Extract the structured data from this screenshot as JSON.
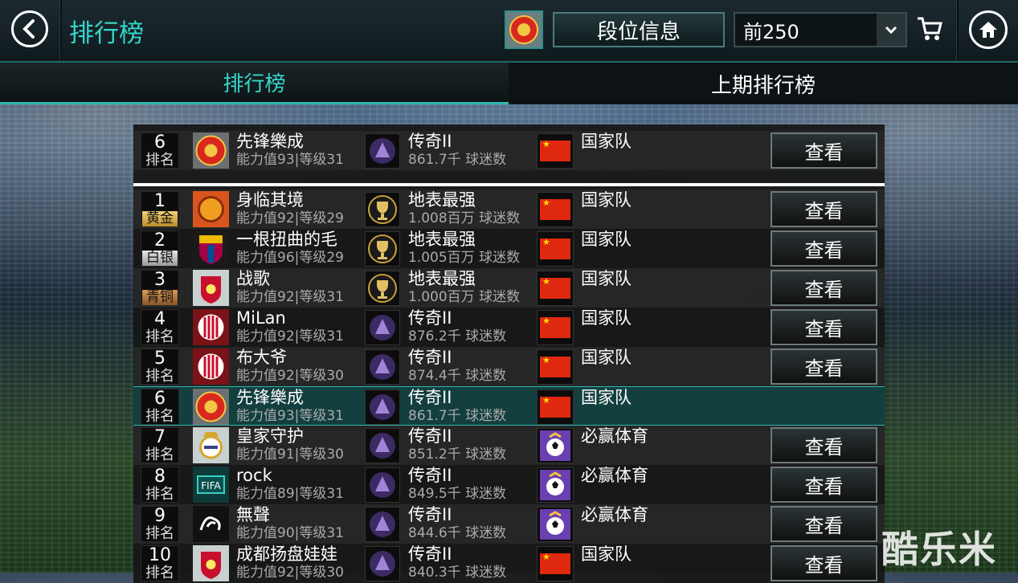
{
  "header": {
    "title": "排行榜",
    "rank_info_label": "段位信息",
    "range_value": "前250"
  },
  "tabs": [
    {
      "label": "排行榜",
      "active": true
    },
    {
      "label": "上期排行榜",
      "active": false
    }
  ],
  "my_row": {
    "rank": "6",
    "rank_label": "排名",
    "name": "先锋樂成",
    "stats": "能力值93|等级31",
    "division": "传奇II",
    "fans": "861.7千 球迷数",
    "team": "国家队",
    "view": "查看"
  },
  "rows": [
    {
      "rank": "1",
      "rank_label": "黄金",
      "tier": "gold",
      "club": "dragon",
      "name": "身临其境",
      "stats": "能力值92|等级29",
      "division": "地表最强",
      "div_icon": "trophy",
      "fans": "1.008百万 球迷数",
      "nation": "cn",
      "team": "国家队",
      "view": "查看"
    },
    {
      "rank": "2",
      "rank_label": "白银",
      "tier": "plat",
      "club": "barca",
      "name": "一根扭曲的毛",
      "stats": "能力值96|等级29",
      "division": "地表最强",
      "div_icon": "trophy",
      "fans": "1.005百万 球迷数",
      "nation": "cn",
      "team": "国家队",
      "view": "查看"
    },
    {
      "rank": "3",
      "rank_label": "青铜",
      "tier": "bronze",
      "club": "liverpool",
      "name": "战歌",
      "stats": "能力值92|等级31",
      "division": "地表最强",
      "div_icon": "trophy",
      "fans": "1.000百万 球迷数",
      "nation": "cn",
      "team": "国家队",
      "view": "查看"
    },
    {
      "rank": "4",
      "rank_label": "排名",
      "tier": "",
      "club": "milan",
      "name": "MiLan",
      "stats": "能力值92|等级31",
      "division": "传奇II",
      "div_icon": "legend",
      "fans": "876.2千 球迷数",
      "nation": "cn",
      "team": "国家队",
      "view": "查看"
    },
    {
      "rank": "5",
      "rank_label": "排名",
      "tier": "",
      "club": "milan",
      "name": "布大爷",
      "stats": "能力值92|等级30",
      "division": "传奇II",
      "div_icon": "legend",
      "fans": "874.4千 球迷数",
      "nation": "cn",
      "team": "国家队",
      "view": "查看"
    },
    {
      "rank": "6",
      "rank_label": "排名",
      "tier": "",
      "club": "manutd",
      "name": "先锋樂成",
      "stats": "能力值93|等级31",
      "division": "传奇II",
      "div_icon": "legend",
      "fans": "861.7千 球迷数",
      "nation": "cn",
      "team": "国家队",
      "view": "",
      "me": true
    },
    {
      "rank": "7",
      "rank_label": "排名",
      "tier": "",
      "club": "realmadrid",
      "name": "皇家守护",
      "stats": "能力值91|等级30",
      "division": "传奇II",
      "div_icon": "legend",
      "fans": "851.2千 球迷数",
      "nation": "ball",
      "team": "必赢体育",
      "view": "查看"
    },
    {
      "rank": "8",
      "rank_label": "排名",
      "tier": "",
      "club": "fifa",
      "name": "rock",
      "stats": "能力值89|等级31",
      "division": "传奇II",
      "div_icon": "legend",
      "fans": "849.5千 球迷数",
      "nation": "ball",
      "team": "必赢体育",
      "view": "查看"
    },
    {
      "rank": "9",
      "rank_label": "排名",
      "tier": "",
      "club": "derby",
      "name": "無聲",
      "stats": "能力值90|等级31",
      "division": "传奇II",
      "div_icon": "legend",
      "fans": "844.6千 球迷数",
      "nation": "ball",
      "team": "必赢体育",
      "view": "查看"
    },
    {
      "rank": "10",
      "rank_label": "排名",
      "tier": "",
      "club": "liverpool",
      "name": "成都扬盘娃娃",
      "stats": "能力值92|等级30",
      "division": "传奇II",
      "div_icon": "legend",
      "fans": "840.3千 球迷数",
      "nation": "cn",
      "team": "国家队",
      "view": "查看"
    }
  ],
  "watermark": "酷乐米",
  "colors": {
    "accent": "#35d6cc",
    "highlight_row": "#133f3f",
    "flag_red": "#de2910"
  }
}
